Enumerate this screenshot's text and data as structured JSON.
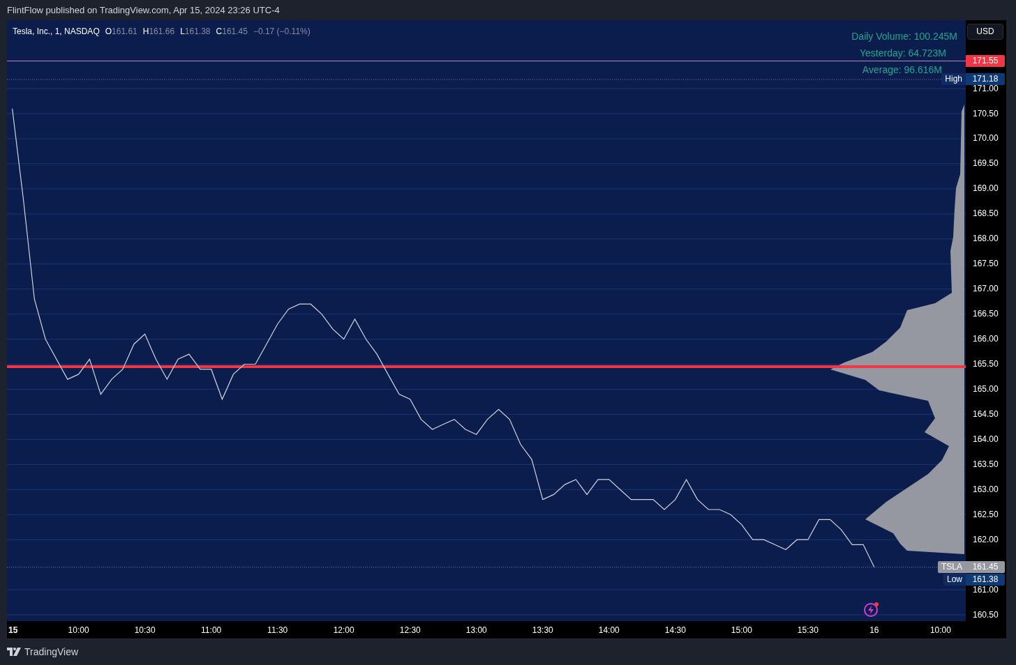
{
  "header": {
    "text": "FlintFlow published on TradingView.com, Apr 15, 2024 23:26 UTC-4"
  },
  "legend": {
    "title": "Tesla, Inc., 1, NASDAQ",
    "ohlc": [
      {
        "label": "O",
        "value": "161.61"
      },
      {
        "label": "H",
        "value": "161.66"
      },
      {
        "label": "L",
        "value": "161.38"
      },
      {
        "label": "C",
        "value": "161.45"
      }
    ],
    "change": "−0.17 (−0.11%)"
  },
  "volume_info": [
    "Daily Volume: 100.245M",
    "Yesterday: 64.723M",
    "Average: 96.616M"
  ],
  "currency_button": "USD",
  "price_labels": [
    {
      "kind": "alert",
      "value": "171.55"
    },
    {
      "kind": "high",
      "tag": "High",
      "value": "171.18"
    },
    {
      "kind": "current",
      "tag": "TSLA",
      "value": "161.45"
    },
    {
      "kind": "low",
      "tag": "Low",
      "value": "161.38"
    }
  ],
  "day_markers": [
    "15",
    "16",
    "10:00"
  ],
  "chart_data": {
    "type": "line",
    "grid": true,
    "xlim": [
      9.46,
      16.69
    ],
    "ylim": [
      160.375,
      172.363
    ],
    "ref_lines": [
      {
        "axis": "y",
        "value": 171.55,
        "color": "#b58bc7"
      },
      {
        "axis": "y",
        "value": 171.18,
        "color": "#6f7fa8"
      },
      {
        "axis": "y",
        "value": 165.45,
        "color": "#f23645"
      },
      {
        "axis": "y",
        "value": 161.45,
        "color": "#6f7fa8"
      }
    ],
    "x": [
      9.5,
      9.583,
      9.667,
      9.75,
      9.833,
      9.917,
      10,
      10.083,
      10.167,
      10.25,
      10.333,
      10.417,
      10.5,
      10.583,
      10.667,
      10.75,
      10.833,
      10.917,
      11,
      11.083,
      11.167,
      11.25,
      11.333,
      11.417,
      11.5,
      11.583,
      11.667,
      11.75,
      11.833,
      11.917,
      12,
      12.083,
      12.167,
      12.25,
      12.333,
      12.417,
      12.5,
      12.583,
      12.667,
      12.75,
      12.833,
      12.917,
      13,
      13.083,
      13.167,
      13.25,
      13.333,
      13.417,
      13.5,
      13.583,
      13.667,
      13.75,
      13.833,
      13.917,
      14,
      14.083,
      14.167,
      14.25,
      14.333,
      14.417,
      14.5,
      14.583,
      14.667,
      14.75,
      14.833,
      14.917,
      15,
      15.083,
      15.167,
      15.25,
      15.333,
      15.417,
      15.5,
      15.583,
      15.667,
      15.75,
      15.833,
      15.917,
      16
    ],
    "xticks": [
      {
        "value": 10,
        "label": "10:00"
      },
      {
        "value": 10.5,
        "label": "10:30"
      },
      {
        "value": 11,
        "label": "11:00"
      },
      {
        "value": 11.5,
        "label": "11:30"
      },
      {
        "value": 12,
        "label": "12:00"
      },
      {
        "value": 12.5,
        "label": "12:30"
      },
      {
        "value": 13,
        "label": "13:00"
      },
      {
        "value": 13.5,
        "label": "13:30"
      },
      {
        "value": 14,
        "label": "14:00"
      },
      {
        "value": 14.5,
        "label": "14:30"
      },
      {
        "value": 15,
        "label": "15:00"
      },
      {
        "value": 15.5,
        "label": "15:30"
      }
    ],
    "series": [
      {
        "color": "#d1d4dc",
        "values": [
          170.6,
          168.8,
          166.8,
          166.0,
          165.6,
          165.2,
          165.3,
          165.6,
          164.9,
          165.2,
          165.4,
          165.9,
          166.1,
          165.6,
          165.2,
          165.6,
          165.7,
          165.4,
          165.4,
          164.8,
          165.3,
          165.5,
          165.5,
          165.9,
          166.3,
          166.6,
          166.7,
          166.7,
          166.5,
          166.2,
          166.0,
          166.4,
          166.0,
          165.7,
          165.3,
          164.9,
          164.8,
          164.4,
          164.2,
          164.3,
          164.4,
          164.2,
          164.1,
          164.4,
          164.6,
          164.4,
          163.9,
          163.6,
          162.8,
          162.9,
          163.1,
          163.2,
          162.9,
          163.2,
          163.2,
          163.0,
          162.8,
          162.8,
          162.8,
          162.6,
          162.8,
          163.2,
          162.8,
          162.6,
          162.6,
          162.5,
          162.3,
          162.0,
          162.0,
          161.9,
          161.8,
          162.0,
          162.0,
          162.4,
          162.4,
          162.2,
          161.9,
          161.9,
          161.45
        ]
      }
    ],
    "yticks": [
      {
        "value": 160.5,
        "label": "160.50"
      },
      {
        "value": 161,
        "label": "161.00"
      },
      {
        "value": 162,
        "label": "162.00"
      },
      {
        "value": 162.5,
        "label": "162.50"
      },
      {
        "value": 163,
        "label": "163.00"
      },
      {
        "value": 163.5,
        "label": "163.50"
      },
      {
        "value": 164,
        "label": "164.00"
      },
      {
        "value": 164.5,
        "label": "164.50"
      },
      {
        "value": 165,
        "label": "165.00"
      },
      {
        "value": 165.5,
        "label": "165.50"
      },
      {
        "value": 166,
        "label": "166.00"
      },
      {
        "value": 166.5,
        "label": "166.50"
      },
      {
        "value": 167,
        "label": "167.00"
      },
      {
        "value": 167.5,
        "label": "167.50"
      },
      {
        "value": 168,
        "label": "168.00"
      },
      {
        "value": 168.5,
        "label": "168.50"
      },
      {
        "value": 169,
        "label": "169.00"
      },
      {
        "value": 169.5,
        "label": "169.50"
      },
      {
        "value": 170,
        "label": "170.00"
      },
      {
        "value": 170.5,
        "label": "170.50"
      },
      {
        "value": 171,
        "label": "171.00"
      }
    ]
  },
  "footer": {
    "brand": "TradingView"
  }
}
